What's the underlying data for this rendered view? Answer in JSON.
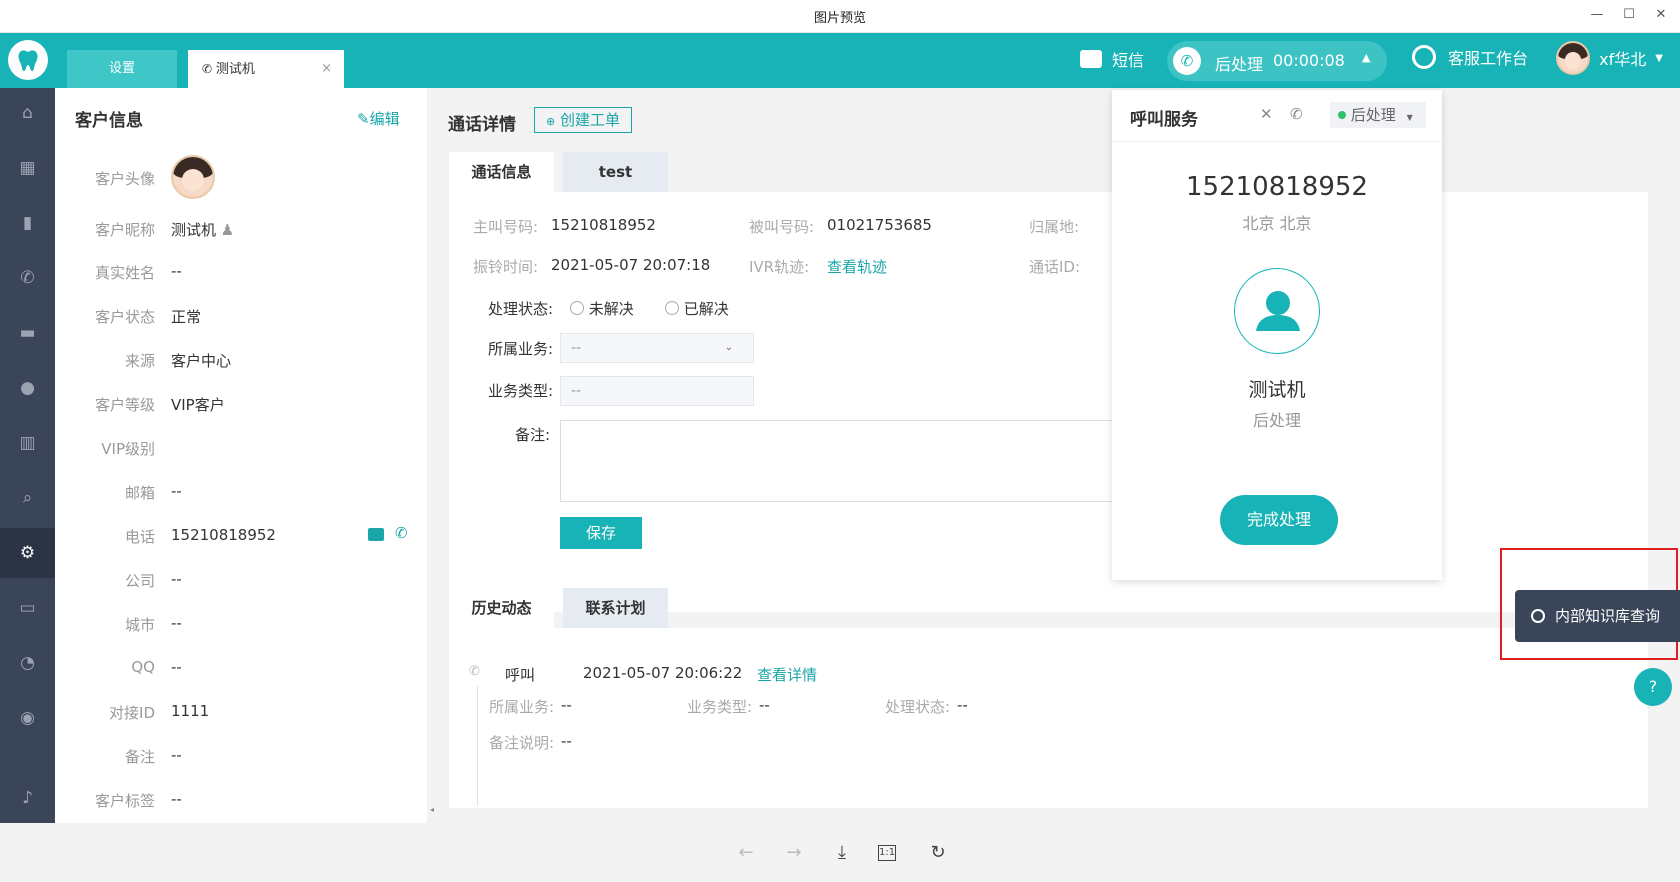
{
  "window": {
    "title": "图片预览",
    "controls": {
      "minimize": "—",
      "maximize": "☐",
      "close": "✕"
    }
  },
  "topbar": {
    "tabs": [
      {
        "label": "设置"
      },
      {
        "label": "测试机",
        "close": "×"
      }
    ],
    "sms_label": "短信",
    "call_status": "后处理",
    "call_timer": "00:00:08",
    "workbench_label": "客服工作台",
    "user_name": "xf华北"
  },
  "customer": {
    "title": "客户信息",
    "edit_label": "编辑",
    "fields": [
      {
        "label": "客户头像",
        "value": ""
      },
      {
        "label": "客户昵称",
        "value": "测试机"
      },
      {
        "label": "真实姓名",
        "value": "--"
      },
      {
        "label": "客户状态",
        "value": "正常"
      },
      {
        "label": "来源",
        "value": "客户中心"
      },
      {
        "label": "客户等级",
        "value": "VIP客户"
      },
      {
        "label": "VIP级别",
        "value": ""
      },
      {
        "label": "邮箱",
        "value": "--"
      },
      {
        "label": "电话",
        "value": "15210818952"
      },
      {
        "label": "公司",
        "value": "--"
      },
      {
        "label": "城市",
        "value": "--"
      },
      {
        "label": "QQ",
        "value": "--"
      },
      {
        "label": "对接ID",
        "value": "1111"
      },
      {
        "label": "备注",
        "value": "--"
      },
      {
        "label": "客户标签",
        "value": "--"
      }
    ]
  },
  "call_detail": {
    "title": "通话详情",
    "create_ticket_label": "创建工单",
    "tabs": [
      "通话信息",
      "test"
    ],
    "caller_label": "主叫号码:",
    "caller": "15210818952",
    "callee_label": "被叫号码:",
    "callee": "01021753685",
    "location_label": "归属地:",
    "ring_time_label": "振铃时间:",
    "ring_time": "2021-05-07 20:07:18",
    "ivr_label": "IVR轨迹:",
    "ivr_link": "查看轨迹",
    "call_id_label": "通话ID:",
    "status_label": "处理状态:",
    "status_options": [
      "未解决",
      "已解决"
    ],
    "business_label": "所属业务:",
    "business_value": "--",
    "type_label": "业务类型:",
    "type_value": "--",
    "note_label": "备注:",
    "save_label": "保存"
  },
  "history": {
    "tabs": [
      "历史动态",
      "联系计划"
    ],
    "entry": {
      "kind": "呼叫",
      "time": "2021-05-07 20:06:22",
      "link": "查看详情",
      "business_label": "所属业务:",
      "business_value": "--",
      "type_label": "业务类型:",
      "type_value": "--",
      "status_label": "处理状态:",
      "status_value": "--",
      "remark_label": "备注说明:",
      "remark_value": "--"
    }
  },
  "popup": {
    "title": "呼叫服务",
    "status_label": "后处理",
    "phone": "15210818952",
    "location": "北京 北京",
    "name": "测试机",
    "state": "后处理",
    "finish_label": "完成处理"
  },
  "kb_button": {
    "label": "内部知识库查询"
  },
  "colors": {
    "accent": "#18b3b6",
    "nav_bg": "#3a4559",
    "kb_bg": "#3a4559",
    "highlight": "#e02020"
  }
}
